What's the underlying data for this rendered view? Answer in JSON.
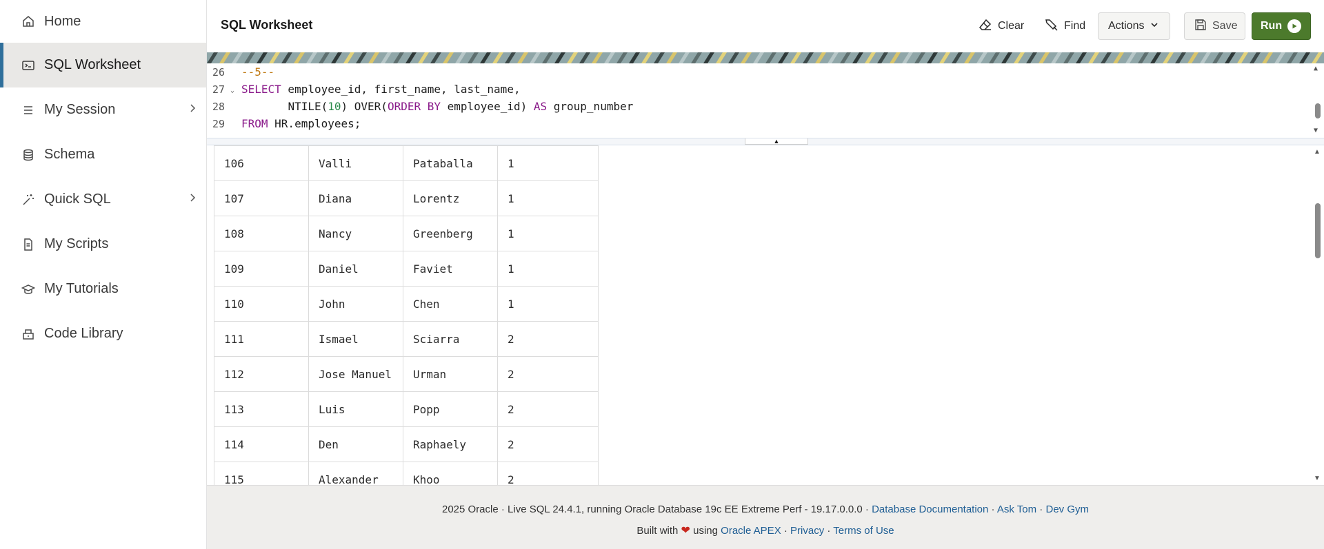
{
  "sidebar": {
    "items": [
      {
        "label": "Home",
        "icon": "home-icon"
      },
      {
        "label": "SQL Worksheet",
        "icon": "terminal-icon"
      },
      {
        "label": "My Session",
        "icon": "list-icon"
      },
      {
        "label": "Schema",
        "icon": "database-icon"
      },
      {
        "label": "Quick SQL",
        "icon": "magic-wand-icon"
      },
      {
        "label": "My Scripts",
        "icon": "document-icon"
      },
      {
        "label": "My Tutorials",
        "icon": "graduation-cap-icon"
      },
      {
        "label": "Code Library",
        "icon": "library-icon"
      }
    ]
  },
  "header": {
    "title": "SQL Worksheet",
    "clear_label": "Clear",
    "find_label": "Find",
    "actions_label": "Actions",
    "save_label": "Save",
    "run_label": "Run"
  },
  "editor": {
    "lines": [
      {
        "number": "26"
      },
      {
        "number": "27"
      },
      {
        "number": "28"
      },
      {
        "number": "29"
      }
    ],
    "code": {
      "l26": "--5--",
      "l27_kw": "SELECT",
      "l27_rest": " employee_id, first_name, last_name,",
      "l28_indent": "       ",
      "l28_a": "NTILE(",
      "l28_num": "10",
      "l28_b": ") OVER(",
      "l28_kw1": "ORDER BY",
      "l28_c": " employee_id) ",
      "l28_kw2": "AS",
      "l28_d": " group_number",
      "l29_kw": "FROM",
      "l29_rest": " HR.employees;"
    }
  },
  "results": {
    "rows": [
      [
        "106",
        "Valli",
        "Pataballa",
        "1"
      ],
      [
        "107",
        "Diana",
        "Lorentz",
        "1"
      ],
      [
        "108",
        "Nancy",
        "Greenberg",
        "1"
      ],
      [
        "109",
        "Daniel",
        "Faviet",
        "1"
      ],
      [
        "110",
        "John",
        "Chen",
        "1"
      ],
      [
        "111",
        "Ismael",
        "Sciarra",
        "2"
      ],
      [
        "112",
        "Jose Manuel",
        "Urman",
        "2"
      ],
      [
        "113",
        "Luis",
        "Popp",
        "2"
      ],
      [
        "114",
        "Den",
        "Raphaely",
        "2"
      ],
      [
        "115",
        "Alexander",
        "Khoo",
        "2"
      ]
    ]
  },
  "footer": {
    "copyright": "2025 Oracle · Live SQL 24.4.1, running Oracle Database 19c EE Extreme Perf - 19.17.0.0.0 · ",
    "db_docs": "Database Documentation",
    "sep1": " · ",
    "ask_tom": "Ask Tom",
    "sep2": " · ",
    "dev_gym": "Dev Gym",
    "built_with": "Built with ",
    "heart": "❤",
    "using": " using ",
    "apex": "Oracle APEX",
    "sep3": " · ",
    "privacy": "Privacy",
    "sep4": " · ",
    "terms": "Terms of Use"
  },
  "colors": {
    "accent": "#2f6f9b",
    "run_button": "#4c7a2c",
    "link": "#1f5e94"
  }
}
